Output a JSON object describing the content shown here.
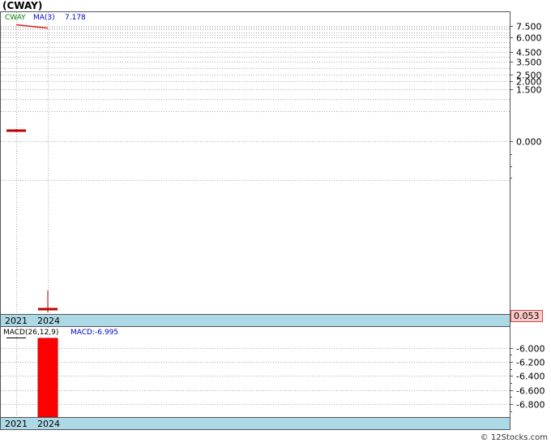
{
  "title": "(CWAY)",
  "watermark": "© 12Stocks.com",
  "colors": {
    "price_bar": "#c00000",
    "ma_line": "#e02020",
    "ticker_legend": "#008000",
    "legend_blue": "#0000cc",
    "year_band": "#add8e6",
    "current_price_bg": "#fcc8c8",
    "macd_bar": "#ff0000",
    "grid": "#aaaaaa"
  },
  "chart_data": [
    {
      "type": "bar",
      "panel": "price",
      "legend": {
        "ticker": "CWAY",
        "ma_label": "MA(3)",
        "ma_value": "7.178"
      },
      "y_tick_labels": [
        "7.500",
        "6.000",
        "4.500",
        "3.500",
        "2.500",
        "2.000",
        "1.500",
        "0.000"
      ],
      "x_labels": [
        "2021",
        "2024"
      ],
      "current_price_label": "0.053",
      "bars": [
        {
          "x": "2021",
          "open": 0.66,
          "high": 0.68,
          "low": 0.64,
          "close": 0.66
        },
        {
          "x": "2024",
          "open": 0.053,
          "high": 0.7,
          "low": 0.0,
          "close": 0.053
        }
      ],
      "ma_line": [
        {
          "x": "2021",
          "value": 7.6
        },
        {
          "x": "2024",
          "value": 7.178
        }
      ]
    },
    {
      "type": "bar",
      "panel": "macd",
      "legend": {
        "macd_label": "MACD(26,12,9)",
        "macd_value": "MACD:-6.995"
      },
      "y_tick_labels": [
        "-6.000",
        "-6.200",
        "-6.400",
        "-6.600",
        "-6.800"
      ],
      "x_labels": [
        "2021",
        "2024"
      ],
      "bars": [
        {
          "x": "2024",
          "value": -6.995
        }
      ]
    }
  ]
}
